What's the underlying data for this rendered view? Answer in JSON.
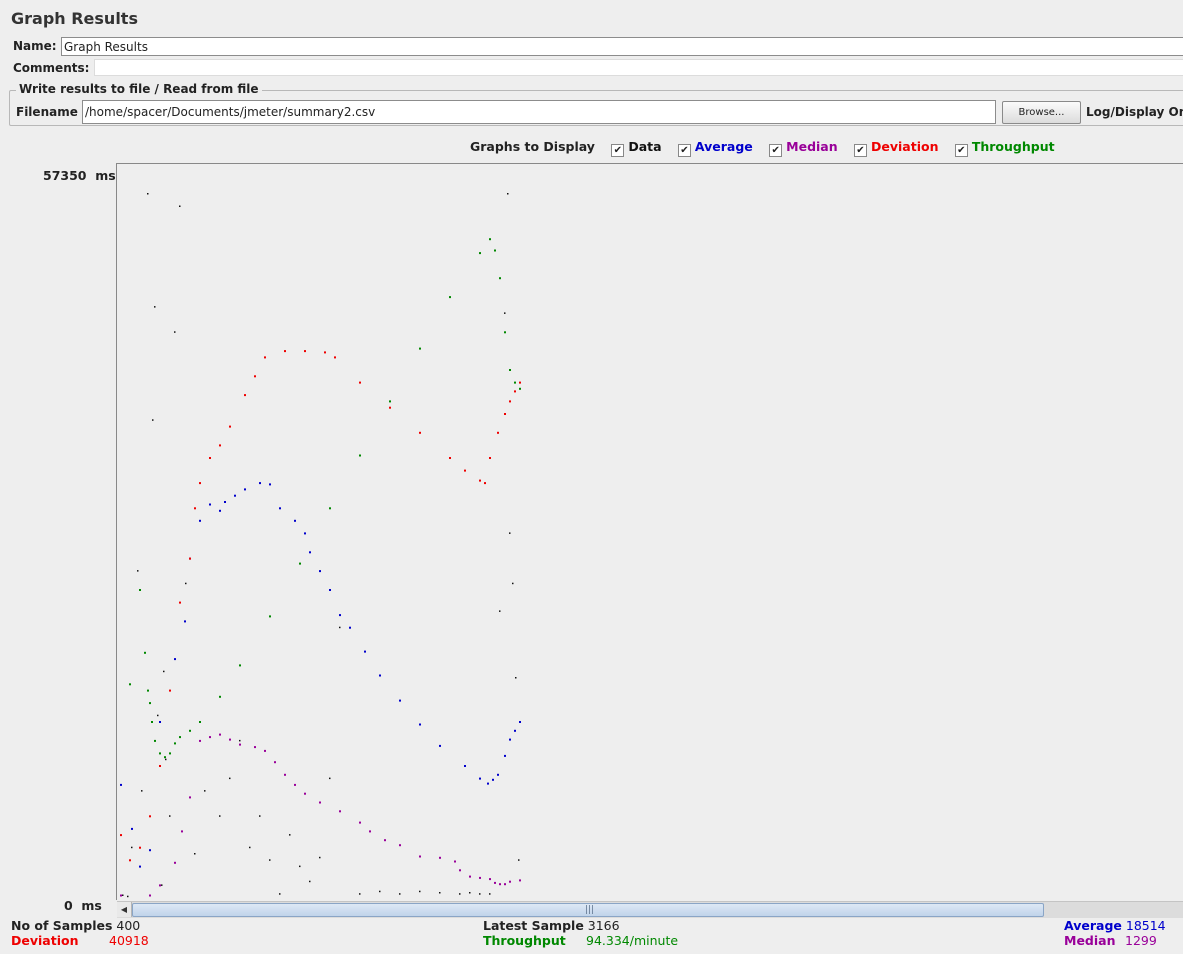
{
  "panel": {
    "title": "Graph Results"
  },
  "form": {
    "name_label": "Name:",
    "name_value": "Graph Results",
    "comments_label": "Comments:",
    "comments_value": ""
  },
  "file_section": {
    "legend": "Write results to file / Read from file",
    "filename_label": "Filename",
    "filename_value": "/home/spacer/Documents/jmeter/summary2.csv",
    "browse_label": "Browse...",
    "log_display_label": "Log/Display Only:"
  },
  "graphs_to_display": {
    "label": "Graphs to Display",
    "options": [
      {
        "label": "Data",
        "checked": true,
        "color": "#111111"
      },
      {
        "label": "Average",
        "checked": true,
        "color": "#0000cc"
      },
      {
        "label": "Median",
        "checked": true,
        "color": "#990099"
      },
      {
        "label": "Deviation",
        "checked": true,
        "color": "#ee0000"
      },
      {
        "label": "Throughput",
        "checked": true,
        "color": "#008800"
      }
    ]
  },
  "chart_data": {
    "type": "scatter",
    "ylim": [
      0,
      57350
    ],
    "y_tick_labels": [
      "57350  ms",
      "0  ms"
    ],
    "x_samples_range": [
      0,
      400
    ],
    "series": [
      {
        "name": "Average",
        "color": "#0000cc",
        "x": [
          1,
          12,
          20,
          30,
          40,
          55,
          65,
          70,
          80,
          90,
          100,
          105,
          115,
          125,
          140,
          150,
          160,
          175,
          185,
          190,
          200,
          210,
          220,
          230,
          245,
          260,
          280,
          300,
          320,
          345,
          360,
          368,
          373,
          378,
          385,
          390,
          395,
          400
        ],
        "y": [
          9000,
          5500,
          2500,
          3800,
          14000,
          19000,
          22000,
          27000,
          30000,
          31300,
          30800,
          31500,
          32000,
          32500,
          33000,
          32900,
          31000,
          30000,
          29000,
          27500,
          26000,
          24500,
          22500,
          21500,
          19600,
          17700,
          15700,
          13800,
          12100,
          10500,
          9500,
          9100,
          9400,
          9800,
          11300,
          12600,
          13300,
          14000
        ]
      },
      {
        "name": "Median",
        "color": "#990099",
        "x": [
          1,
          30,
          40,
          55,
          62,
          70,
          80,
          90,
          100,
          110,
          120,
          135,
          145,
          155,
          165,
          175,
          185,
          200,
          220,
          240,
          250,
          265,
          280,
          300,
          320,
          335,
          340,
          350,
          360,
          370,
          375,
          380,
          385,
          390,
          400
        ],
        "y": [
          200,
          200,
          1000,
          2800,
          5300,
          8000,
          12500,
          12800,
          13000,
          12600,
          12200,
          12000,
          11700,
          10800,
          9800,
          9000,
          8300,
          7600,
          6900,
          6000,
          5300,
          4600,
          4200,
          3300,
          3200,
          2900,
          2200,
          1700,
          1600,
          1500,
          1200,
          1100,
          1100,
          1300,
          1400
        ]
      },
      {
        "name": "Deviation",
        "color": "#ee0000",
        "x": [
          1,
          10,
          20,
          30,
          40,
          50,
          60,
          70,
          75,
          80,
          90,
          100,
          110,
          125,
          135,
          145,
          165,
          185,
          205,
          215,
          240,
          270,
          300,
          330,
          345,
          360,
          365,
          370,
          378,
          385,
          390,
          395,
          400
        ],
        "y": [
          5000,
          3000,
          4000,
          6500,
          10500,
          16500,
          23500,
          27000,
          31000,
          33000,
          35000,
          36000,
          37500,
          40000,
          41500,
          43000,
          43500,
          43500,
          43400,
          43000,
          41000,
          39000,
          37000,
          35000,
          34000,
          33200,
          33000,
          35000,
          37000,
          38500,
          39500,
          40300,
          41000
        ]
      },
      {
        "name": "Throughput",
        "color": "#008800",
        "x": [
          10,
          20,
          25,
          28,
          30,
          32,
          35,
          40,
          45,
          50,
          55,
          60,
          70,
          80,
          100,
          120,
          150,
          180,
          210,
          240,
          270,
          300,
          330,
          360,
          370,
          375,
          380,
          385,
          390,
          395,
          400
        ],
        "y": [
          17000,
          24500,
          19500,
          16500,
          15500,
          14000,
          12500,
          11500,
          11200,
          11500,
          12300,
          12800,
          13300,
          14000,
          16000,
          18500,
          22400,
          26600,
          31000,
          35200,
          39500,
          43700,
          47800,
          51300,
          52400,
          51500,
          49300,
          45000,
          42000,
          41000,
          40500
        ]
      },
      {
        "name": "Data",
        "color": "#111111",
        "x": [
          3,
          8,
          12,
          18,
          22,
          28,
          33,
          35,
          38,
          42,
          44,
          46,
          50,
          55,
          60,
          66,
          75,
          85,
          100,
          110,
          120,
          130,
          140,
          150,
          160,
          170,
          180,
          190,
          200,
          210,
          220,
          240,
          260,
          280,
          300,
          320,
          340,
          350,
          360,
          370,
          380,
          385,
          388,
          390,
          393,
          396,
          399
        ],
        "y": [
          200,
          100,
          4000,
          26000,
          8500,
          56000,
          38000,
          47000,
          14500,
          1000,
          18000,
          11000,
          6500,
          45000,
          55000,
          25000,
          3500,
          8500,
          6500,
          9500,
          12500,
          4000,
          6500,
          3000,
          300,
          5000,
          2500,
          1300,
          3200,
          9500,
          21500,
          300,
          500,
          300,
          500,
          400,
          300,
          400,
          300,
          300,
          22800,
          46500,
          56000,
          29000,
          25000,
          17500,
          3000
        ]
      }
    ]
  },
  "stats": {
    "no_of_samples_label": "No of Samples",
    "no_of_samples_value": "400",
    "deviation_label": "Deviation",
    "deviation_value": "40918",
    "latest_sample_label": "Latest Sample",
    "latest_sample_value": "3166",
    "throughput_label": "Throughput",
    "throughput_value": "94.334/minute",
    "average_label": "Average",
    "average_value": "18514",
    "median_label": "Median",
    "median_value": "1299"
  }
}
